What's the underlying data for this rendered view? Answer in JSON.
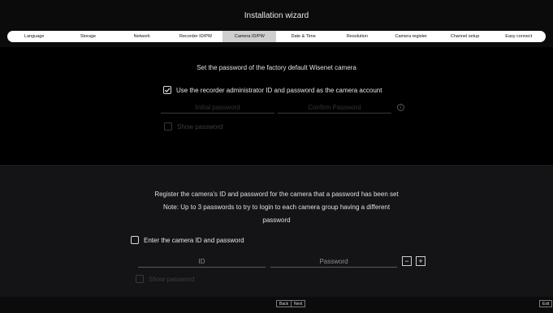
{
  "window": {
    "title": "Installation wizard"
  },
  "steps": [
    {
      "label": "Language",
      "active": false
    },
    {
      "label": "Storage",
      "active": false
    },
    {
      "label": "Network",
      "active": false
    },
    {
      "label": "Recorder ID/PW",
      "active": false
    },
    {
      "label": "Camera ID/PW",
      "active": true
    },
    {
      "label": "Date & Time",
      "active": false
    },
    {
      "label": "Resolution",
      "active": false
    },
    {
      "label": "Camera register",
      "active": false
    },
    {
      "label": "Channel setup",
      "active": false
    },
    {
      "label": "Easy connect",
      "active": false
    }
  ],
  "factory": {
    "heading": "Set the password of the factory default Wisenet camera",
    "use_recorder_label": "Use the recorder administrator ID and password as the camera account",
    "use_recorder_checked": true,
    "initial_password_placeholder": "Initial password",
    "confirm_password_placeholder": "Confirm Password",
    "info_icon": "info-icon",
    "show_password_label": "Show password"
  },
  "register": {
    "heading_line1": "Register the camera's ID and password for the camera that a password has been set",
    "heading_line2": "Note: Up to 3 passwords to try to login to each camera group having a different",
    "heading_line3": "password",
    "enter_label": "Enter the camera ID and password",
    "enter_checked": false,
    "id_placeholder": "ID",
    "password_placeholder": "Password",
    "minus_label": "−",
    "plus_label": "+",
    "show_password_label": "Show password"
  },
  "footer": {
    "back_label": "Back",
    "next_label": "Next",
    "exit_label": "Exit"
  },
  "colors": {
    "background": "#0b0b0c",
    "step_bar": "#ffffff",
    "active_step": "#cfcfcf"
  }
}
